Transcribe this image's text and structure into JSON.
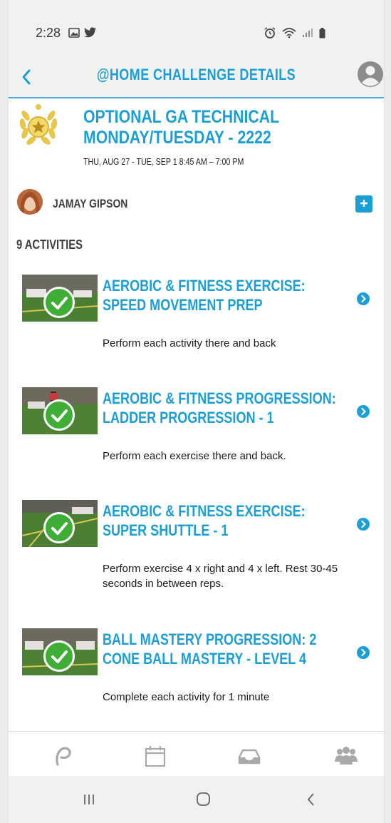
{
  "status_bar": {
    "time": "2:28"
  },
  "header": {
    "title": "@HOME CHALLENGE DETAILS"
  },
  "challenge": {
    "title": "OPTIONAL GA TECHNICAL MONDAY/TUESDAY - 2222",
    "dates": "THU, AUG 27 - TUE, SEP 1 8:45 AM – 7:00 PM",
    "coach_name": "JAMAY GIPSON",
    "activities_count": "9 ACTIVITIES"
  },
  "activities": [
    {
      "title": "AEROBIC & FITNESS EXERCISE: SPEED MOVEMENT PREP",
      "description": "Perform each activity there and back",
      "completed": true
    },
    {
      "title": "AEROBIC & FITNESS PROGRESSION: LADDER PROGRESSION - 1",
      "description": "Perform each exercise there and back.",
      "completed": true
    },
    {
      "title": "AEROBIC & FITNESS EXERCISE: SUPER SHUTTLE - 1",
      "description": "Perform exercise 4 x right and 4 x left. Rest 30-45 seconds in between reps.",
      "completed": true
    },
    {
      "title": "BALL MASTERY PROGRESSION: 2 CONE BALL MASTERY - LEVEL 4",
      "description": "Complete each activity for 1 minute",
      "completed": true
    }
  ],
  "tab_bar": {
    "icons": [
      "playmetrics-logo-icon",
      "calendar-icon",
      "inbox-icon",
      "team-icon"
    ]
  },
  "nav_bar": {
    "icons": [
      "recent-apps-icon",
      "home-icon",
      "back-icon"
    ]
  },
  "colors": {
    "accent": "#1c9fd7",
    "check": "#3fae36",
    "divider": "#4aa9dc"
  }
}
